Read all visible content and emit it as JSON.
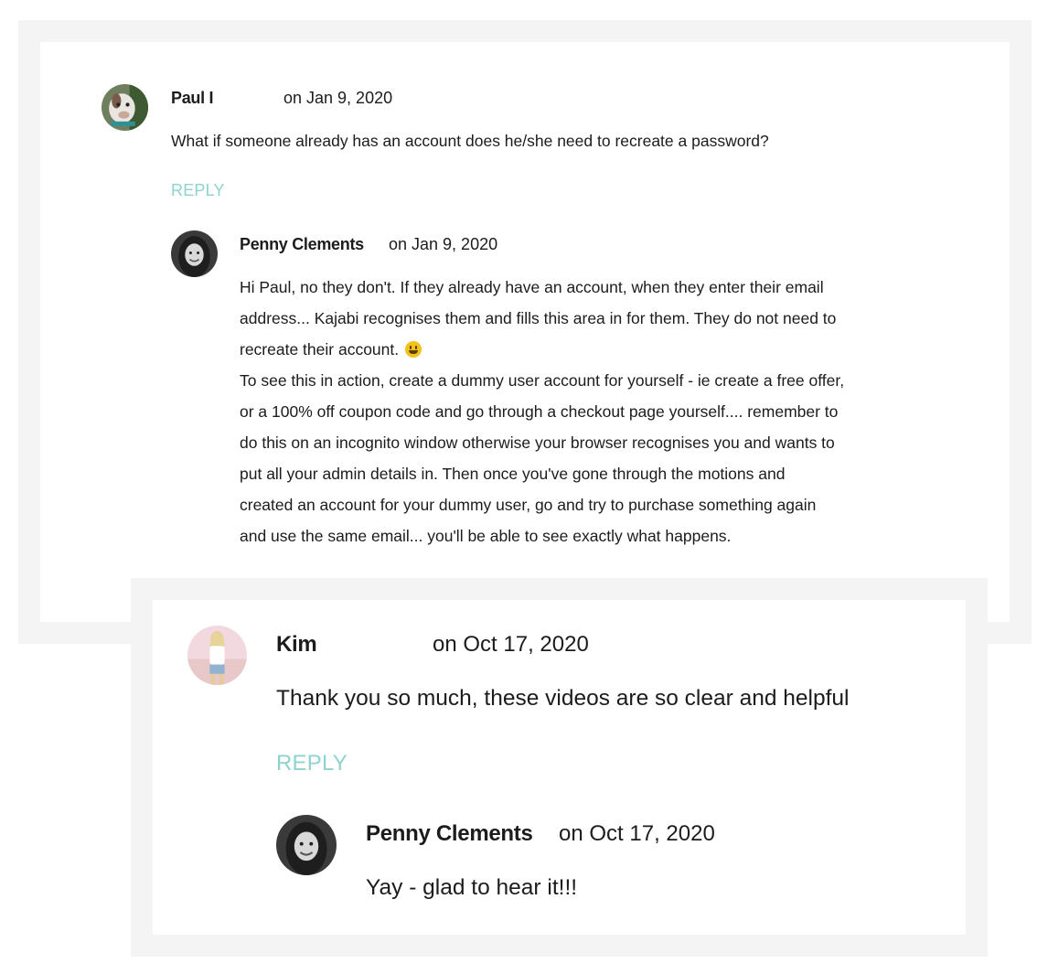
{
  "comments": [
    {
      "author": "Paul I",
      "date": "on Jan 9, 2020",
      "avatar_icon": "dog-photo-avatar",
      "text": "What if someone already has an account does he/she need to recreate a password?",
      "reply_label": "REPLY",
      "replies": [
        {
          "author": "Penny Clements",
          "date": "on Jan 9, 2020",
          "avatar_icon": "woman-photo-avatar",
          "lines": [
            "Hi Paul, no they don't. If they already have an account, when they enter their email",
            "address... Kajabi recognises them and fills this area in for them. They do not need to",
            "recreate their account.",
            "To see this in action, create a dummy user account for yourself - ie create a free offer,",
            "or a 100% off coupon code and go through a checkout page yourself.... remember to",
            "do this on an incognito window otherwise your browser recognises you and wants to",
            "put all your admin details in. Then once you've gone through the motions and",
            "created an account for your dummy user, go and try to purchase something again",
            "and use the same email... you'll be able to see exactly what happens."
          ],
          "emoji_icon": "grinning-face-emoji"
        }
      ]
    },
    {
      "author": "Kim",
      "date": "on Oct 17, 2020",
      "avatar_icon": "woman-beach-photo-avatar",
      "text": "Thank you so much, these videos are so clear and helpful",
      "reply_label": "REPLY",
      "replies": [
        {
          "author": "Penny Clements",
          "date": "on Oct 17, 2020",
          "avatar_icon": "woman-photo-avatar",
          "text": "Yay - glad to hear it!!!"
        }
      ]
    }
  ],
  "colors": {
    "reply": "#8fd3cf",
    "card_border": "#f4f4f4",
    "text": "#1c1c1c"
  }
}
